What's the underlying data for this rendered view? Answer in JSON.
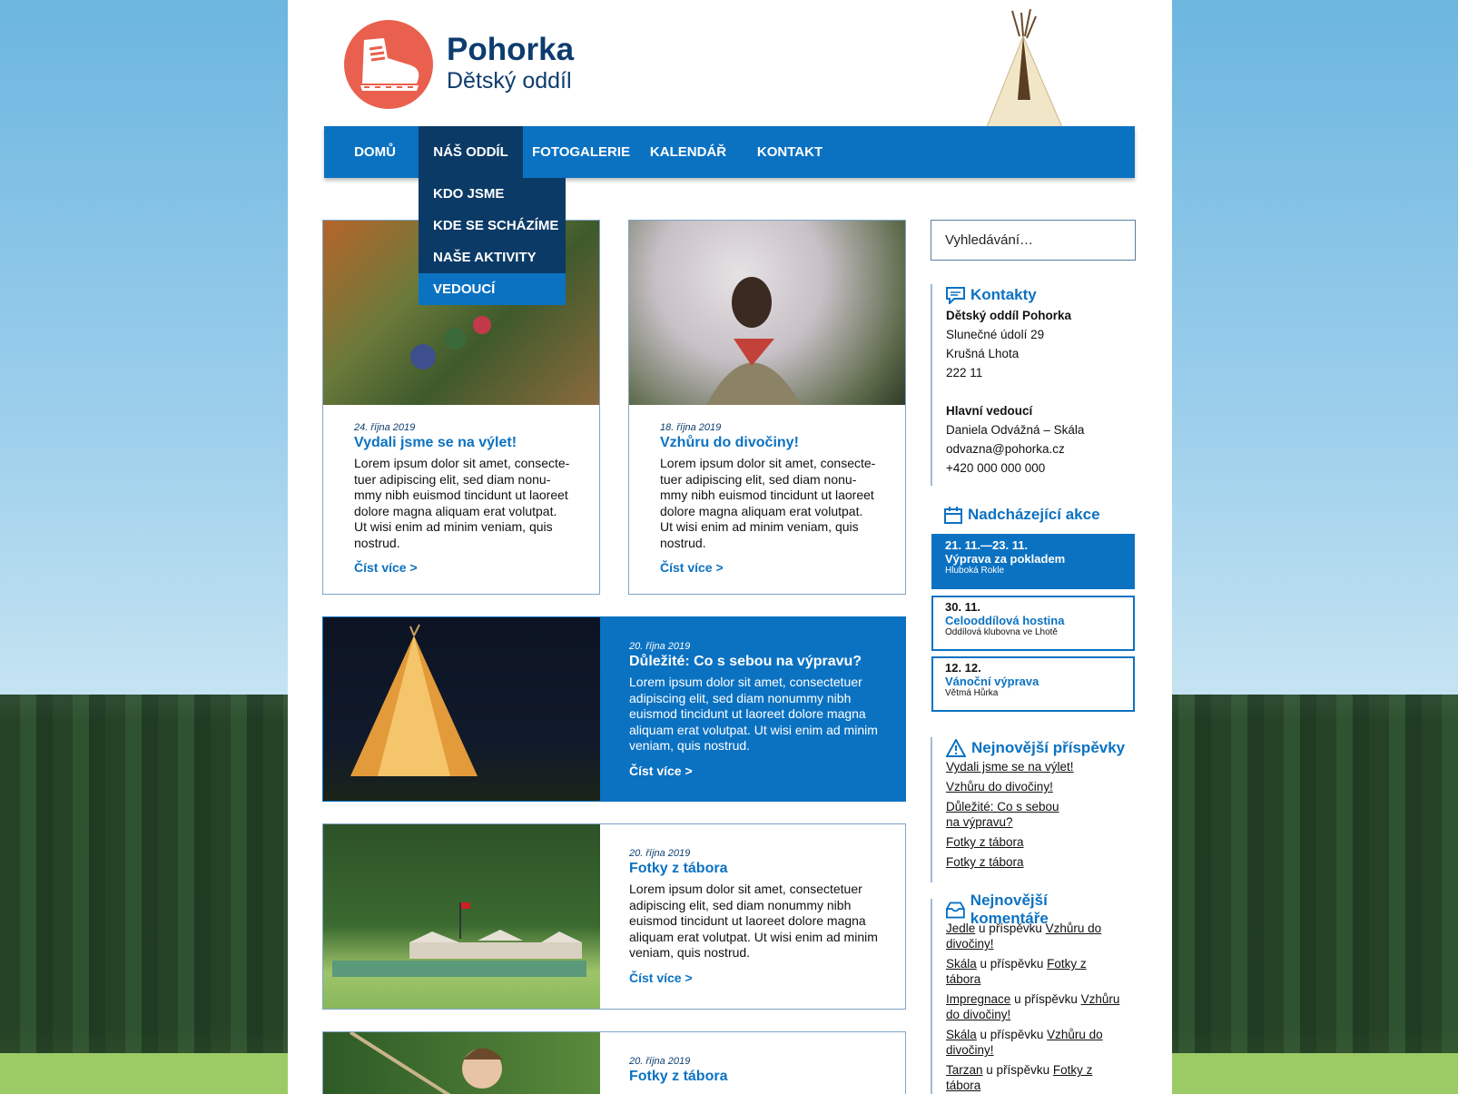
{
  "brand": {
    "name": "Pohorka",
    "subtitle": "Dětský oddíl"
  },
  "nav": {
    "items": [
      "DOMŮ",
      "NÁŠ ODDÍL",
      "FOTOGALERIE",
      "KALENDÁŘ",
      "KONTAKT"
    ],
    "dropdown": [
      "KDO JSME",
      "KDE SE SCHÁZÍME",
      "NAŠE AKTIVITY",
      "VEDOUCÍ"
    ]
  },
  "posts": [
    {
      "date": "24. října 2019",
      "title": "Vydali jsme se na výlet!",
      "text": "Lorem ipsum dolor sit amet, consecte­tuer adipiscing elit, sed diam nonu­mmy nibh euismod tincidunt ut lao­reet dolore magna aliquam erat volut­pat. Ut wisi enim ad minim veniam, quis nostrud.",
      "more": "Číst více >"
    },
    {
      "date": "18. října 2019",
      "title": "Vzhůru do divočiny!",
      "text": "Lorem ipsum dolor sit amet, consecte­tuer adipiscing elit, sed diam nonu­mmy nibh euismod tincidunt ut lao­reet dolore magna aliquam erat volut­pat. Ut wisi enim ad minim veniam, quis nostrud.",
      "more": "Číst více >"
    },
    {
      "date": "20. října 2019",
      "title": "Důležité: Co s sebou na výpravu?",
      "text": "Lorem ipsum dolor sit amet, consectetuer adipiscing elit, sed diam nonummy nibh euismod tincidunt ut laoreet dolore magna aliquam erat volutpat. Ut wisi enim ad minim veniam, quis nostrud.",
      "more": "Číst více >"
    },
    {
      "date": "20. října 2019",
      "title": "Fotky z tábora",
      "text": "Lorem ipsum dolor sit amet, consectetuer adipiscing elit, sed diam nonummy nibh euismod tincidunt ut laoreet dolore magna aliquam erat volutpat. Ut wisi enim ad minim veniam, quis nostrud.",
      "more": "Číst více >"
    },
    {
      "date": "20. října 2019",
      "title": "Fotky z tábora"
    }
  ],
  "sidebar": {
    "search_placeholder": "Vyhledávání…",
    "contacts": {
      "title": "Kontakty",
      "lines": [
        "Dětský oddíl Pohorka",
        "Slunečné údolí 29",
        "Krušná Lhota",
        "222 11"
      ],
      "leader_title": "Hlavní vedoucí",
      "leader": [
        "Daniela Odvážná – Skála",
        "odvazna@pohorka.cz",
        "+420 000 000 000"
      ]
    },
    "events": {
      "title": "Nadcházející akce",
      "items": [
        {
          "date": "21. 11.—23. 11.",
          "name": "Výprava za pokladem",
          "place": "Hluboká Rokle"
        },
        {
          "date": "30. 11.",
          "name": "Celooddílová hostina",
          "place": "Oddílová klubovna ve Lhotě"
        },
        {
          "date": "12. 12.",
          "name": "Vánoční výprava",
          "place": "Větmá Hůrka"
        }
      ]
    },
    "latest": {
      "title": "Nejnovější příspěvky",
      "items": [
        "Vydali jsme se na výlet!",
        "Vzhůru do divočiny!",
        "Důležité: Co s sebou na výpravu?",
        "Fotky z tábora",
        "Fotky z tábora"
      ]
    },
    "comments": {
      "title": "Nejnovější komentáře",
      "joiner": "u příspěvku",
      "items": [
        {
          "author": "Jedle",
          "post": "Vzhůru do divočiny!"
        },
        {
          "author": "Skála",
          "post": "Fotky z tábora"
        },
        {
          "author": "Impregnace",
          "post": "Vzhůru do divočiny!"
        },
        {
          "author": "Skála",
          "post": "Vzhůru do divočiny!"
        },
        {
          "author": "Tarzan",
          "post": "Fotky z tábora"
        }
      ]
    }
  }
}
